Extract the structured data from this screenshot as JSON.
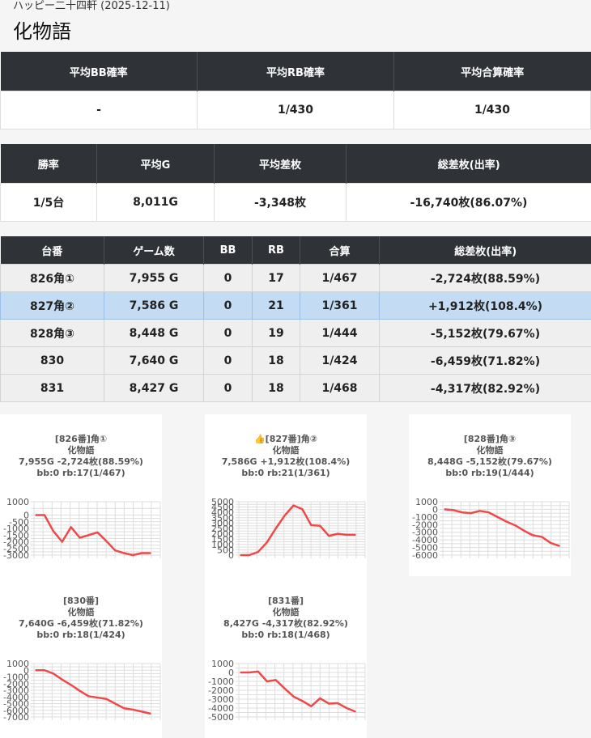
{
  "header": {
    "breadcrumb": "ハッピー二十四軒 (2025-12-11)",
    "title": "化物語"
  },
  "summary1": {
    "headers": [
      "平均BB確率",
      "平均RB確率",
      "平均合算確率"
    ],
    "values": [
      "-",
      "1/430",
      "1/430"
    ]
  },
  "summary2": {
    "headers": [
      "勝率",
      "平均G",
      "平均差枚",
      "総差枚(出率)"
    ],
    "values": [
      "1/5台",
      "8,011G",
      "-3,348枚",
      "-16,740枚(86.07%)"
    ]
  },
  "machines": {
    "headers": [
      "台番",
      "ゲーム数",
      "BB",
      "RB",
      "合算",
      "総差枚(出率)"
    ],
    "rows": [
      [
        "826角①",
        "7,955 G",
        "0",
        "17",
        "1/467",
        "-2,724枚(88.59%)"
      ],
      [
        "827角②",
        "7,586 G",
        "0",
        "21",
        "1/361",
        "+1,912枚(108.4%)"
      ],
      [
        "828角③",
        "8,448 G",
        "0",
        "19",
        "1/444",
        "-5,152枚(79.67%)"
      ],
      [
        "830",
        "7,640 G",
        "0",
        "18",
        "1/424",
        "-6,459枚(71.82%)"
      ],
      [
        "831",
        "8,427 G",
        "0",
        "18",
        "1/468",
        "-4,317枚(82.92%)"
      ]
    ]
  },
  "charts": {
    "line_color": "#f04848",
    "grid_color": "#dddddd"
  },
  "chart_data": [
    {
      "type": "line",
      "caption": [
        "[826番]角①",
        "化物語",
        "7,955G -2,724枚(88.59%)",
        "bb:0 rb:17(1/467)"
      ],
      "yticks": [
        1000,
        0,
        -500,
        -1000,
        -1500,
        -2000,
        -2500,
        -3000
      ],
      "ylim": [
        -3000,
        1000
      ],
      "values": [
        0,
        0,
        -1200,
        -2000,
        -900,
        -1700,
        -1500,
        -1300,
        -1950,
        -2650,
        -2850,
        -3000,
        -2850,
        -2850
      ]
    },
    {
      "type": "line",
      "caption": [
        "[827番]角②",
        "化物語",
        "7,586G +1,912枚(108.4%)",
        "bb:0 rb:21(1/361)"
      ],
      "title_icon": "👍",
      "yticks": [
        5000,
        4500,
        4000,
        3500,
        3000,
        2500,
        2000,
        1500,
        1000,
        500,
        0
      ],
      "ylim": [
        0,
        5000
      ],
      "values": [
        0,
        0,
        300,
        1200,
        2500,
        3700,
        4650,
        4300,
        2800,
        2750,
        1800,
        2000,
        1900,
        1900
      ]
    },
    {
      "type": "line",
      "caption": [
        "[828番]角③",
        "化物語",
        "8,448G -5,152枚(79.67%)",
        "bb:0 rb:19(1/444)"
      ],
      "yticks": [
        1000,
        0,
        -1000,
        -2000,
        -3000,
        -4000,
        -5000,
        -6000
      ],
      "ylim": [
        -6000,
        1000
      ],
      "values": [
        0,
        -100,
        -400,
        -500,
        -200,
        -400,
        -1000,
        -1600,
        -2100,
        -2800,
        -3400,
        -3600,
        -4400,
        -4800
      ]
    },
    {
      "type": "line",
      "caption": [
        "[830番]",
        "化物語",
        "7,640G -6,459枚(71.82%)",
        "bb:0 rb:18(1/424)"
      ],
      "yticks": [
        1000,
        0,
        -1000,
        -2000,
        -3000,
        -4000,
        -5000,
        -6000,
        -7000
      ],
      "ylim": [
        -7000,
        1000
      ],
      "values": [
        0,
        0,
        -500,
        -1400,
        -2200,
        -3100,
        -3900,
        -4100,
        -4300,
        -5000,
        -5700,
        -5900,
        -6200,
        -6500
      ]
    },
    {
      "type": "line",
      "caption": [
        "[831番]",
        "化物語",
        "8,427G -4,317枚(82.92%)",
        "bb:0 rb:18(1/468)"
      ],
      "yticks": [
        1000,
        0,
        -1000,
        -2000,
        -3000,
        -4000,
        -5000
      ],
      "ylim": [
        -5000,
        1000
      ],
      "values": [
        0,
        0,
        100,
        -1000,
        -850,
        -1800,
        -2700,
        -3200,
        -3800,
        -2900,
        -3500,
        -3450,
        -4000,
        -4400
      ]
    }
  ]
}
